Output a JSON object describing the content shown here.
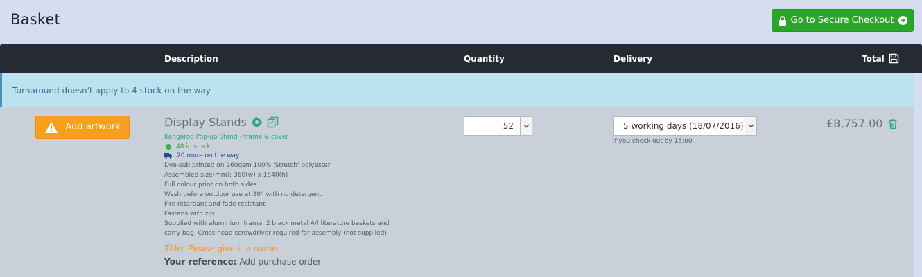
{
  "header": {
    "title": "Basket",
    "checkout_label": "Go to Secure Checkout"
  },
  "table": {
    "col_description": "Description",
    "col_quantity": "Quantity",
    "col_delivery": "Delivery",
    "col_total": "Total"
  },
  "notice": "Turnaround doesn't apply to 4 stock on the way",
  "item": {
    "artwork_label": "Add artwork",
    "name": "Display Stands",
    "subtitle": "Kangaroo Pop-up Stand - frame & cover",
    "in_stock": "48 in stock",
    "on_the_way": "20 more on the way",
    "specs": [
      "Dye-sub printed on 260gsm 100% 'Stretch' polyester",
      "Assembled size(mm): 360(w) x 1540(h)",
      "Full colour print on both sides",
      "Wash before outdoor use at 30° with no detergent",
      "Fire retardant and fade resistant",
      "Fastens with zip",
      "Supplied with aluminium frame, 2 black metal A4 literature baskets and",
      "carry bag. Cross head screwdriver required for assembly (not supplied)."
    ],
    "title_prompt": "Title: Please give it a name...",
    "reference_label": "Your reference:",
    "reference_placeholder": "Add purchase order",
    "quantity": "52",
    "delivery": "5 working days (18/07/2016)",
    "delivery_note": "if you check out by 15:00",
    "total": "£8,757.00"
  },
  "colors": {
    "checkout_green": "#2aa62a",
    "artwork_orange": "#f7a01e",
    "header_dark": "#262a33",
    "notice_blue": "#bce2ef",
    "teal_icon": "#2aa68a"
  },
  "icons": [
    "lock-icon",
    "arrow-circle-right-icon",
    "save-icon",
    "warning-icon",
    "gear-icon",
    "copy-icon",
    "dot-icon",
    "truck-icon",
    "chevron-down-icon",
    "trash-icon"
  ]
}
